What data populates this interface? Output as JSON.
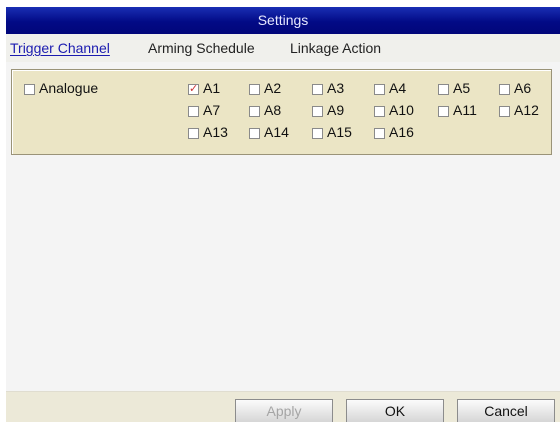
{
  "window": {
    "title": "Settings"
  },
  "tabs": [
    {
      "label": "Trigger Channel",
      "active": true
    },
    {
      "label": "Arming Schedule",
      "active": false
    },
    {
      "label": "Linkage Action",
      "active": false
    }
  ],
  "trigger": {
    "group_label": "Analogue",
    "group_checked": false,
    "channels": [
      {
        "label": "A1",
        "checked": true
      },
      {
        "label": "A2",
        "checked": false
      },
      {
        "label": "A3",
        "checked": false
      },
      {
        "label": "A4",
        "checked": false
      },
      {
        "label": "A5",
        "checked": false
      },
      {
        "label": "A6",
        "checked": false
      },
      {
        "label": "A7",
        "checked": false
      },
      {
        "label": "A8",
        "checked": false
      },
      {
        "label": "A9",
        "checked": false
      },
      {
        "label": "A10",
        "checked": false
      },
      {
        "label": "A11",
        "checked": false
      },
      {
        "label": "A12",
        "checked": false
      },
      {
        "label": "A13",
        "checked": false
      },
      {
        "label": "A14",
        "checked": false
      },
      {
        "label": "A15",
        "checked": false
      },
      {
        "label": "A16",
        "checked": false
      }
    ]
  },
  "buttons": {
    "apply": {
      "label": "Apply",
      "enabled": false
    },
    "ok": {
      "label": "OK",
      "enabled": true
    },
    "cancel": {
      "label": "Cancel",
      "enabled": true
    }
  },
  "colors": {
    "title_bar": "#020a86",
    "active_tab": "#1b1bb0",
    "group_background": "#ebe5c5",
    "check_mark": "#cc3333"
  }
}
